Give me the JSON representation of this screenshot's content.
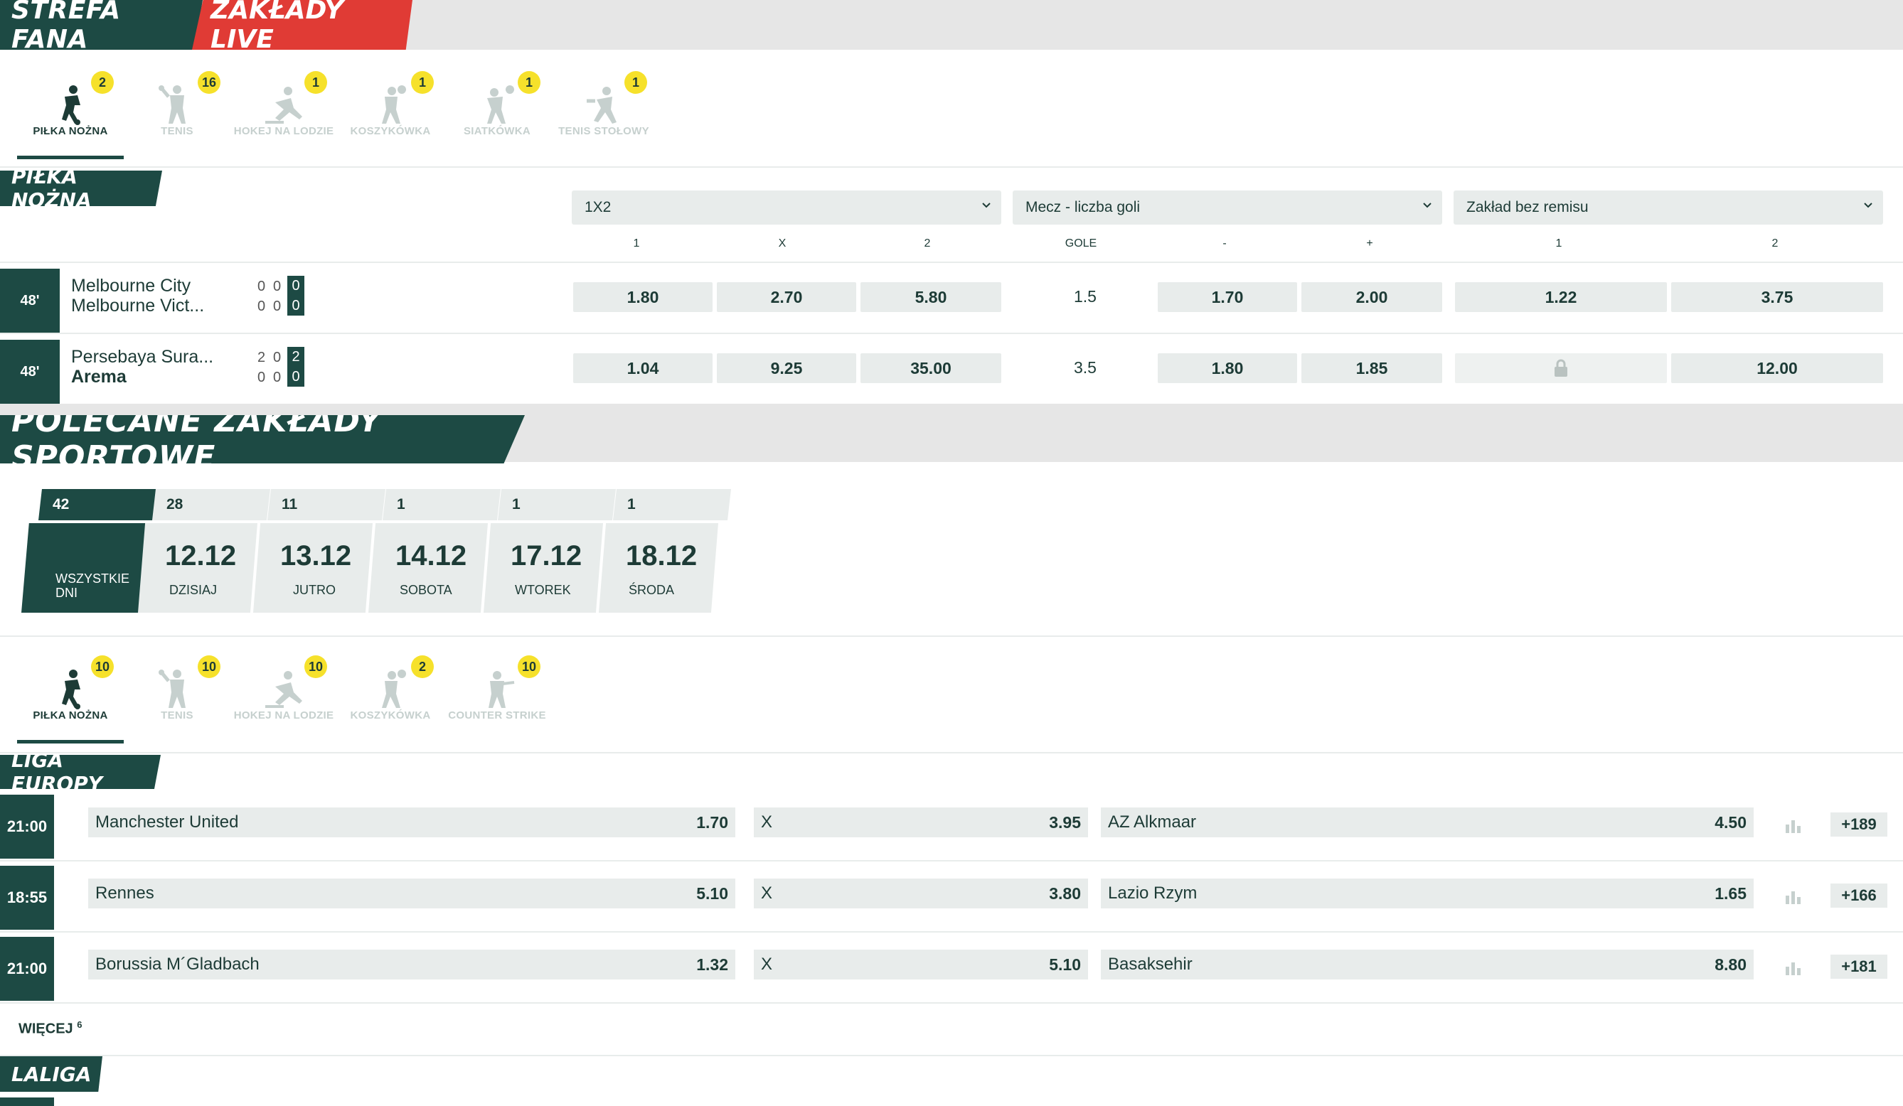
{
  "top_tabs": {
    "fan_zone": "STREFA FANA",
    "live": "ZAKŁADY LIVE"
  },
  "live_sports": [
    {
      "label": "PIŁKA NOŻNA",
      "count": "2",
      "icon": "football-player-icon"
    },
    {
      "label": "TENIS",
      "count": "16",
      "icon": "tennis-player-icon"
    },
    {
      "label": "HOKEJ NA LODZIE",
      "count": "1",
      "icon": "ice-hockey-player-icon"
    },
    {
      "label": "KOSZYKÓWKA",
      "count": "1",
      "icon": "basketball-player-icon"
    },
    {
      "label": "SIATKÓWKA",
      "count": "1",
      "icon": "volleyball-player-icon"
    },
    {
      "label": "TENIS STOŁOWY",
      "count": "1",
      "icon": "table-tennis-player-icon"
    }
  ],
  "live_section": {
    "title": "PIŁKA NOŻNA",
    "selects": [
      "1X2",
      "Mecz - liczba goli",
      "Zakład bez remisu"
    ],
    "col_heads": [
      "1",
      "X",
      "2",
      "GOLE",
      "-",
      "+",
      "1",
      "2"
    ],
    "matches": [
      {
        "minute": "48'",
        "home": "Melbourne City",
        "away": "Melbourne Vict...",
        "home_half": [
          "0",
          "0"
        ],
        "away_half": [
          "0",
          "0"
        ],
        "home_total": "0",
        "away_total": "0",
        "odds_1x2": [
          "1.80",
          "2.70",
          "5.80"
        ],
        "goals_line": "1.5",
        "goals_odds": [
          "1.70",
          "2.00"
        ],
        "dnb": [
          "1.22",
          "3.75"
        ]
      },
      {
        "minute": "48'",
        "home": "Persebaya Sura...",
        "away": "Arema",
        "home_half": [
          "2",
          "0"
        ],
        "away_half": [
          "0",
          "0"
        ],
        "home_total": "2",
        "away_total": "0",
        "odds_1x2": [
          "1.04",
          "9.25",
          "35.00"
        ],
        "goals_line": "3.5",
        "goals_odds": [
          "1.80",
          "1.85"
        ],
        "dnb": [
          "",
          "12.00"
        ]
      }
    ]
  },
  "recommended": {
    "title": "POLECANE ZAKŁADY SPORTOWE",
    "days": [
      {
        "count": "42",
        "date": "",
        "name": "WSZYSTKIE DNI"
      },
      {
        "count": "28",
        "date": "12.12",
        "name": "DZISIAJ"
      },
      {
        "count": "11",
        "date": "13.12",
        "name": "JUTRO"
      },
      {
        "count": "1",
        "date": "14.12",
        "name": "SOBOTA"
      },
      {
        "count": "1",
        "date": "17.12",
        "name": "WTOREK"
      },
      {
        "count": "1",
        "date": "18.12",
        "name": "ŚRODA"
      }
    ],
    "sports": [
      {
        "label": "PIŁKA NOŻNA",
        "count": "10",
        "icon": "football-player-icon"
      },
      {
        "label": "TENIS",
        "count": "10",
        "icon": "tennis-player-icon"
      },
      {
        "label": "HOKEJ NA LODZIE",
        "count": "10",
        "icon": "ice-hockey-player-icon"
      },
      {
        "label": "KOSZYKÓWKA",
        "count": "2",
        "icon": "basketball-player-icon"
      },
      {
        "label": "COUNTER STRIKE",
        "count": "10",
        "icon": "counter-strike-icon"
      }
    ]
  },
  "liga_europy": {
    "title": "LIGA EUROPY",
    "matches": [
      {
        "time": "21:00",
        "home": "Manchester United",
        "home_odd": "1.70",
        "draw": "X",
        "draw_odd": "3.95",
        "away": "AZ Alkmaar",
        "away_odd": "4.50",
        "more": "+189"
      },
      {
        "time": "18:55",
        "home": "Rennes",
        "home_odd": "5.10",
        "draw": "X",
        "draw_odd": "3.80",
        "away": "Lazio Rzym",
        "away_odd": "1.65",
        "more": "+166"
      },
      {
        "time": "21:00",
        "home": "Borussia M´Gladbach",
        "home_odd": "1.32",
        "draw": "X",
        "draw_odd": "5.10",
        "away": "Basaksehir",
        "away_odd": "8.80",
        "more": "+181"
      }
    ],
    "more_label": "WIĘCEJ",
    "more_count": "6"
  },
  "laliga": {
    "title": "LALIGA"
  },
  "colors": {
    "brand_dark": "#1d4a44",
    "live_red": "#e03b35",
    "badge_yellow": "#f6e12b",
    "cell_bg": "#e8eceb"
  }
}
